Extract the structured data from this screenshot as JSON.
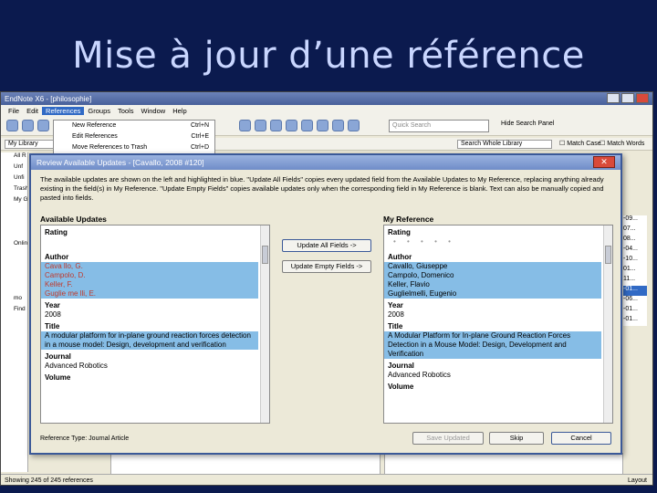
{
  "slide": {
    "title": "Mise à jour d’une référence"
  },
  "window": {
    "title": "EndNote X6 - [philosophie]"
  },
  "menubar": [
    "File",
    "Edit",
    "References",
    "Groups",
    "Tools",
    "Window",
    "Help"
  ],
  "toolbar": {
    "quick_search_placeholder": "Quick Search",
    "hide_search": "Hide Search Panel"
  },
  "references_menu": [
    {
      "label": "New Reference",
      "shortcut": "Ctrl+N"
    },
    {
      "label": "Edit References",
      "shortcut": "Ctrl+E"
    },
    {
      "label": "Move References to Trash",
      "shortcut": "Ctrl+D"
    }
  ],
  "library_bar": {
    "library": "My Library",
    "search_scope": "Search Whole Library",
    "match_case": "Match Case",
    "match_words": "Match Words"
  },
  "left_panel": [
    "All R",
    "Unf",
    "Unfi",
    "Trash",
    "My G",
    "",
    "",
    "",
    "Onlin",
    "",
    "",
    "",
    "",
    "mo",
    "Find"
  ],
  "right_column": [
    "-09...",
    "07...",
    "08...",
    "-04...",
    "-10...",
    "01...",
    "11...",
    "-01...",
    "-06...",
    "-01...",
    "-01..."
  ],
  "status": {
    "count": "Showing 245 of 245 references",
    "layout": "Layout"
  },
  "dialog": {
    "title": "Review Available Updates - [Cavallo, 2008 #120]",
    "info": "The available updates are shown on the left and highlighted in blue. \"Update All Fields\" copies every updated field from the Available Updates to My Reference, replacing anything already existing in the field(s) in My Reference. \"Update Empty Fields\" copies available updates only when the corresponding field in My Reference is blank. Text can also be manually copied and pasted into fields.",
    "available_label": "Available Updates",
    "my_reference_label": "My Reference",
    "update_all": "Update All Fields ->",
    "update_empty": "Update Empty Fields ->",
    "reference_type": "Reference Type: Journal Article",
    "save_updated": "Save Updated",
    "skip": "Skip",
    "cancel": "Cancel",
    "available": {
      "rating_label": "Rating",
      "author_label": "Author",
      "authors": [
        "Cava llo, G.",
        "Campolo, D.",
        "Keller, F.",
        "Guglie me lli, E."
      ],
      "year_label": "Year",
      "year": "2008",
      "title_label": "Title",
      "title": "A modular platform for in-plane ground reaction forces detection in a mouse model: Design, development and verification",
      "journal_label": "Journal",
      "journal": "Advanced Robotics",
      "volume_label": "Volume"
    },
    "mine": {
      "rating_label": "Rating",
      "rating_stars": "• • • • •",
      "author_label": "Author",
      "authors": [
        "Cavallo, Giuseppe",
        "Campolo, Domenico",
        "Keller, Flavio",
        "Guglielmelli, Eugenio"
      ],
      "year_label": "Year",
      "year": "2008",
      "title_label": "Title",
      "title": "A Modular Platform for In-plane Ground Reaction Forces Detection in a Mouse Model: Design, Development and Verification",
      "journal_label": "Journal",
      "journal": "Advanced Robotics",
      "volume_label": "Volume"
    }
  }
}
